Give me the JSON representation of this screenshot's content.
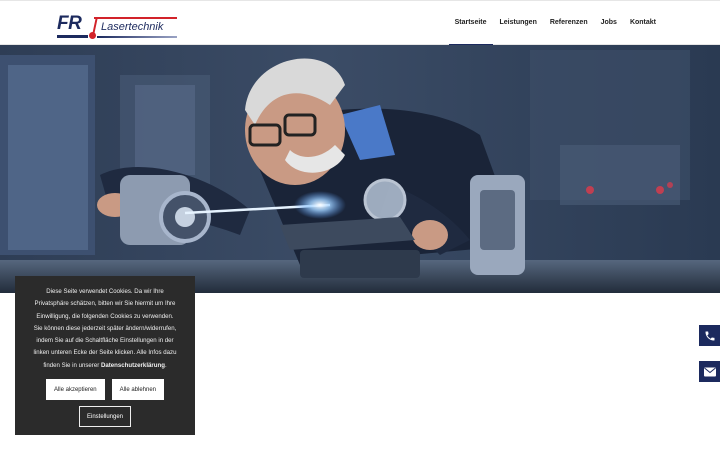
{
  "header": {
    "logo": {
      "brand": "FR",
      "name": "Lasertechnik",
      "colors": {
        "navy": "#1c2a5e",
        "red": "#d2232a"
      }
    },
    "nav": [
      {
        "label": "Startseite",
        "active": true
      },
      {
        "label": "Leistungen",
        "active": false
      },
      {
        "label": "Referenzen",
        "active": false
      },
      {
        "label": "Jobs",
        "active": false
      },
      {
        "label": "Kontakt",
        "active": false
      }
    ]
  },
  "hero": {
    "description_icon": "engineer-with-laser-photo"
  },
  "cookie": {
    "lines": [
      "Diese Seite verwendet Cookies. Da wir Ihre",
      "Privatsphäre schätzen, bitten wir Sie hiermit um Ihre",
      "Einwilligung, die folgenden Cookies zu verwenden.",
      "Sie können diese jederzeit später ändern/widerrufen,",
      "indem Sie auf die Schaltfläche Einstellungen in der",
      "linken unteren Ecke der Seite klicken. Alle Infos dazu"
    ],
    "last_line_prefix": "finden Sie in unserer ",
    "privacy_link": "Datenschutzerklärung",
    "last_line_suffix": ".",
    "accept_label": "Alle akzeptieren",
    "reject_label": "Alle ablehnen",
    "settings_label": "Einstellungen"
  },
  "side": {
    "phone_icon": "phone-icon",
    "mail_icon": "envelope-icon",
    "color": "#1c2a5e"
  }
}
